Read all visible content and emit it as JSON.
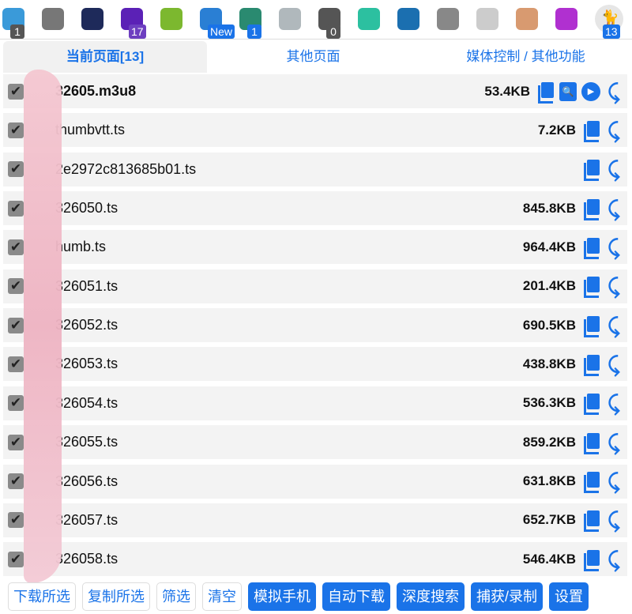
{
  "toolbar": {
    "icons": [
      {
        "name": "download-icon",
        "color": "#3a9ad9",
        "badge": "1",
        "badge_color": "#555"
      },
      {
        "name": "crop-icon",
        "color": "#777",
        "badge": null
      },
      {
        "name": "ip-icon",
        "color": "#1e2a5a",
        "badge": null
      },
      {
        "name": "stack-icon",
        "color": "#5b21b6",
        "badge": "17",
        "badge_color": "#6d3fc0"
      },
      {
        "name": "printer-icon",
        "color": "#7cb82f",
        "badge": null
      },
      {
        "name": "screenshot-icon",
        "color": "#2a7fd4",
        "badge": "New",
        "badge_color": "#1a73e8"
      },
      {
        "name": "palm-icon",
        "color": "#2a8a70",
        "badge": "1",
        "badge_color": "#1a73e8"
      },
      {
        "name": "u-icon",
        "color": "#b0b8bc",
        "badge": null
      },
      {
        "name": "download-circle-icon",
        "color": "#555",
        "badge": "0",
        "badge_color": "#555"
      },
      {
        "name": "chat-icon",
        "color": "#2cc0a0",
        "badge": null
      },
      {
        "name": "lens-icon",
        "color": "#1b6fb0",
        "badge": null
      },
      {
        "name": "openai-icon",
        "color": "#888",
        "badge": null
      },
      {
        "name": "ghost-icon",
        "color": "#ccc",
        "badge": null
      },
      {
        "name": "bullets-icon",
        "color": "#d89a70",
        "badge": null
      },
      {
        "name": "vr-icon",
        "color": "#b030d0",
        "badge": null
      },
      {
        "name": "cat-icon",
        "color": "#e8b020",
        "badge": "13",
        "badge_color": "#1a73e8"
      }
    ]
  },
  "tabs": [
    {
      "label": "当前页面[13]"
    },
    {
      "label": "其他页面"
    },
    {
      "label": "媒体控制 / 其他功能"
    }
  ],
  "files": [
    {
      "name": "32605.m3u8",
      "size": "53.4KB",
      "m3u8": true
    },
    {
      "name": "thumbvtt.ts",
      "size": "7.2KB"
    },
    {
      "name": "2e2972c813685b01.ts",
      "size": ""
    },
    {
      "name": "326050.ts",
      "size": "845.8KB"
    },
    {
      "name": "humb.ts",
      "size": "964.4KB"
    },
    {
      "name": "326051.ts",
      "size": "201.4KB"
    },
    {
      "name": "326052.ts",
      "size": "690.5KB"
    },
    {
      "name": "326053.ts",
      "size": "438.8KB"
    },
    {
      "name": "326054.ts",
      "size": "536.3KB"
    },
    {
      "name": "326055.ts",
      "size": "859.2KB"
    },
    {
      "name": "326056.ts",
      "size": "631.8KB"
    },
    {
      "name": "326057.ts",
      "size": "652.7KB"
    },
    {
      "name": "326058.ts",
      "size": "546.4KB"
    }
  ],
  "buttons": [
    {
      "label": "下载所选",
      "primary": false
    },
    {
      "label": "复制所选",
      "primary": false
    },
    {
      "label": "筛选",
      "primary": false
    },
    {
      "label": "清空",
      "primary": false
    },
    {
      "label": "模拟手机",
      "primary": true
    },
    {
      "label": "自动下载",
      "primary": true
    },
    {
      "label": "深度搜索",
      "primary": true
    },
    {
      "label": "捕获/录制",
      "primary": true
    },
    {
      "label": "设置",
      "primary": true
    }
  ],
  "accent": "#1a73e8"
}
